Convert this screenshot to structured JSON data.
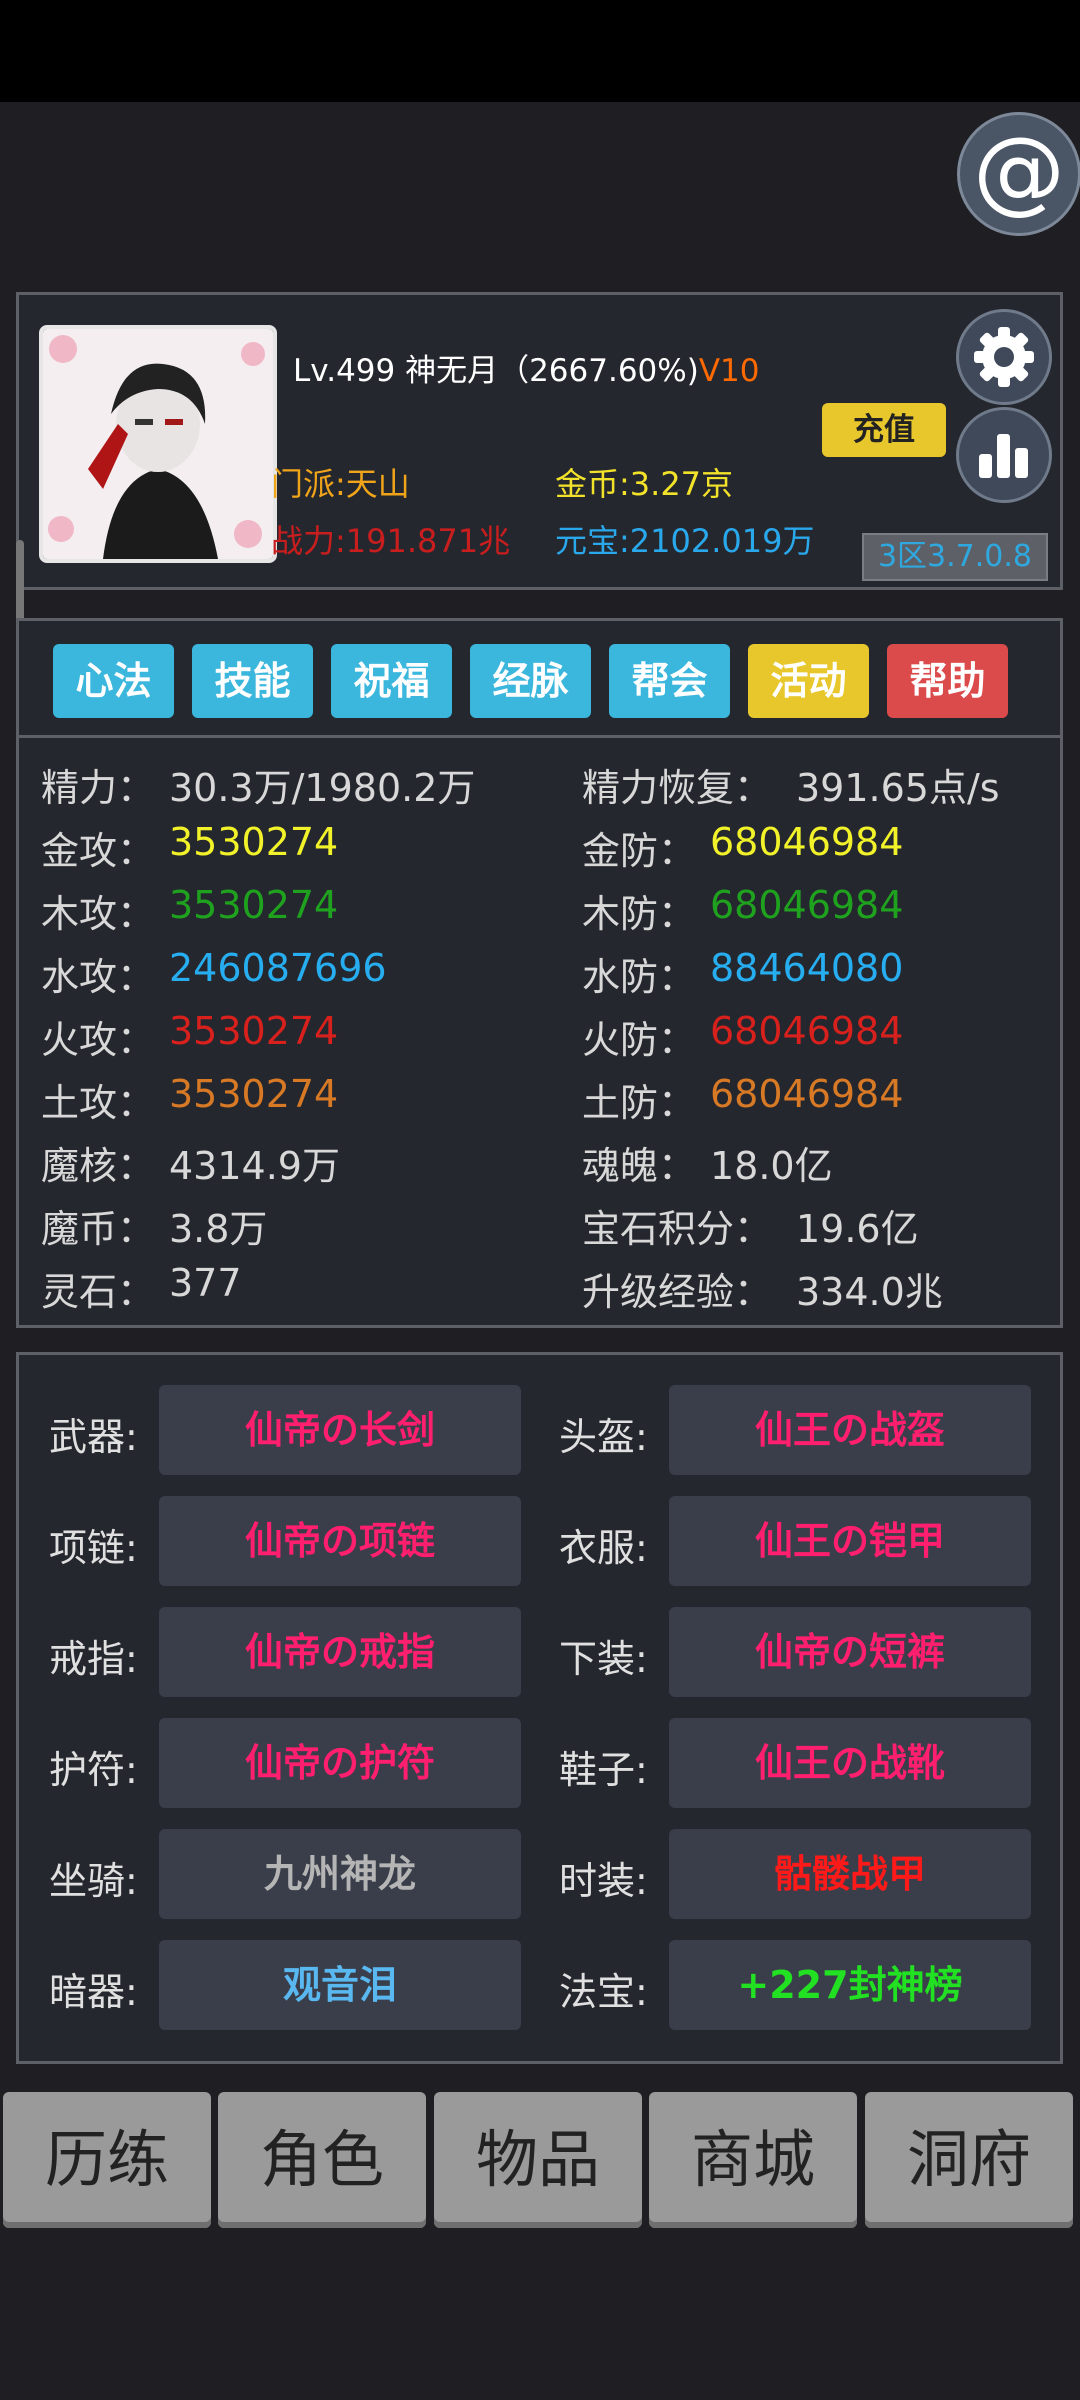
{
  "profile": {
    "name_line": "Lv.499 神无月（2667.60%)",
    "vip": "V10",
    "recharge": "充值",
    "sect": "门派:天山",
    "gold": "金币:3.27京",
    "power": "战力:191.871兆",
    "yuanbao": "元宝:2102.019万",
    "version": "3区3.7.0.8"
  },
  "tabs": [
    {
      "label": "心法",
      "color": "#3bb6dc"
    },
    {
      "label": "技能",
      "color": "#3bb6dc"
    },
    {
      "label": "祝福",
      "color": "#3bb6dc"
    },
    {
      "label": "经脉",
      "color": "#3bb6dc"
    },
    {
      "label": "帮会",
      "color": "#3bb6dc"
    },
    {
      "label": "活动",
      "color": "#e8c72d"
    },
    {
      "label": "帮助",
      "color": "#dc4b4b"
    }
  ],
  "stats": {
    "left": [
      {
        "label": "精力：",
        "value": "30.3万/1980.2万",
        "color": "#d8d8d8"
      },
      {
        "label": "金攻：",
        "value": "3530274",
        "color": "#f2f22a"
      },
      {
        "label": "木攻：",
        "value": "3530274",
        "color": "#1fa31f"
      },
      {
        "label": "水攻：",
        "value": "246087696",
        "color": "#27aef0"
      },
      {
        "label": "火攻：",
        "value": "3530274",
        "color": "#d8201c"
      },
      {
        "label": "土攻：",
        "value": "3530274",
        "color": "#d87a25"
      },
      {
        "label": "魔核：",
        "value": "4314.9万",
        "color": "#d8d8d8"
      },
      {
        "label": "魔币：",
        "value": "3.8万",
        "color": "#d8d8d8"
      },
      {
        "label": "灵石：",
        "value": "377",
        "color": "#d8d8d8"
      }
    ],
    "right": [
      {
        "label": "精力恢复：",
        "value": "391.65点/s",
        "color": "#d8d8d8"
      },
      {
        "label": "金防：",
        "value": "68046984",
        "color": "#f2f22a"
      },
      {
        "label": "木防：",
        "value": "68046984",
        "color": "#1fa31f"
      },
      {
        "label": "水防：",
        "value": "88464080",
        "color": "#27aef0"
      },
      {
        "label": "火防：",
        "value": "68046984",
        "color": "#d8201c"
      },
      {
        "label": "土防：",
        "value": "68046984",
        "color": "#d87a25"
      },
      {
        "label": "魂魄：",
        "value": "18.0亿",
        "color": "#d8d8d8"
      },
      {
        "label": "宝石积分：",
        "value": "19.6亿",
        "color": "#d8d8d8"
      },
      {
        "label": "升级经验：",
        "value": "334.0兆",
        "color": "#d8d8d8"
      }
    ]
  },
  "equipment": [
    {
      "label": "武器:",
      "item": "仙帝の长剑",
      "color": "#ff1f6e"
    },
    {
      "label": "头盔:",
      "item": "仙王の战盔",
      "color": "#ff1f6e"
    },
    {
      "label": "项链:",
      "item": "仙帝の项链",
      "color": "#ff1f6e"
    },
    {
      "label": "衣服:",
      "item": "仙王の铠甲",
      "color": "#ff1f6e"
    },
    {
      "label": "戒指:",
      "item": "仙帝の戒指",
      "color": "#ff1f6e"
    },
    {
      "label": "下装:",
      "item": "仙帝の短裤",
      "color": "#ff1f6e"
    },
    {
      "label": "护符:",
      "item": "仙帝の护符",
      "color": "#ff1f6e"
    },
    {
      "label": "鞋子:",
      "item": "仙王の战靴",
      "color": "#ff1f6e"
    },
    {
      "label": "坐骑:",
      "item": "九州神龙",
      "color": "#b5b5b5"
    },
    {
      "label": "时装:",
      "item": "骷髅战甲",
      "color": "#ff1a1a"
    },
    {
      "label": "暗器:",
      "item": "观音泪",
      "color": "#5ab8f0"
    },
    {
      "label": "法宝:",
      "item": "+227封神榜",
      "color": "#22e022"
    }
  ],
  "bottom_nav": [
    "历练",
    "角色",
    "物品",
    "商城",
    "洞府"
  ]
}
